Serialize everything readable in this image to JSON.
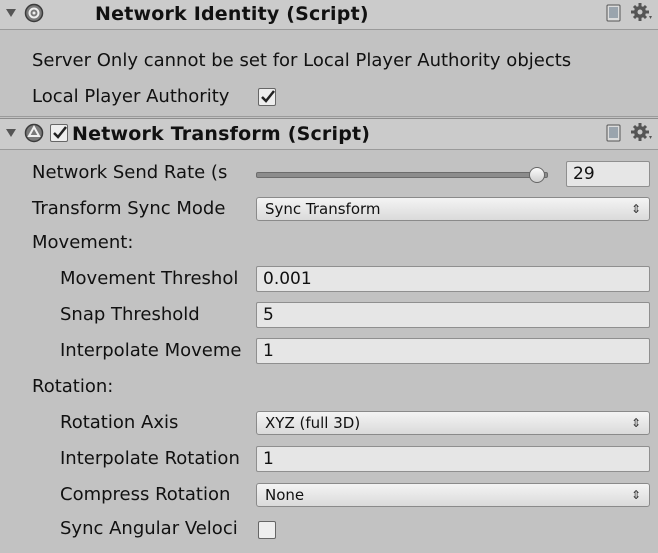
{
  "network_identity": {
    "title": "Network Identity (Script)",
    "warning": "Server Only cannot be set for Local Player Authority objects",
    "local_player_authority_label": "Local Player Authority",
    "local_player_authority_checked": true
  },
  "network_transform": {
    "enabled": true,
    "title": "Network Transform (Script)",
    "send_rate_label": "Network Send Rate (s",
    "send_rate_value": "29",
    "send_rate_level": 0.97,
    "sync_mode_label": "Transform Sync Mode",
    "sync_mode_value": "Sync Transform",
    "movement_header": "Movement:",
    "movement_threshold_label": "Movement Threshol",
    "movement_threshold_value": "0.001",
    "snap_threshold_label": "Snap Threshold",
    "snap_threshold_value": "5",
    "interpolate_movement_label": "Interpolate Moveme",
    "interpolate_movement_value": "1",
    "rotation_header": "Rotation:",
    "rotation_axis_label": "Rotation Axis",
    "rotation_axis_value": "XYZ (full 3D)",
    "interpolate_rotation_label": "Interpolate Rotation",
    "interpolate_rotation_value": "1",
    "compress_rotation_label": "Compress Rotation",
    "compress_rotation_value": "None",
    "sync_angular_velocity_label": "Sync Angular Veloci",
    "sync_angular_velocity_checked": false
  },
  "colors": {
    "background": "#c2c2c2",
    "header": "#cbcbcb",
    "field": "#e6e6e6"
  },
  "icons": [
    "foldout-arrow-icon",
    "network-identity-icon",
    "network-transform-icon",
    "help-book-icon",
    "gear-icon",
    "checkmark-icon",
    "popup-arrows-icon"
  ]
}
